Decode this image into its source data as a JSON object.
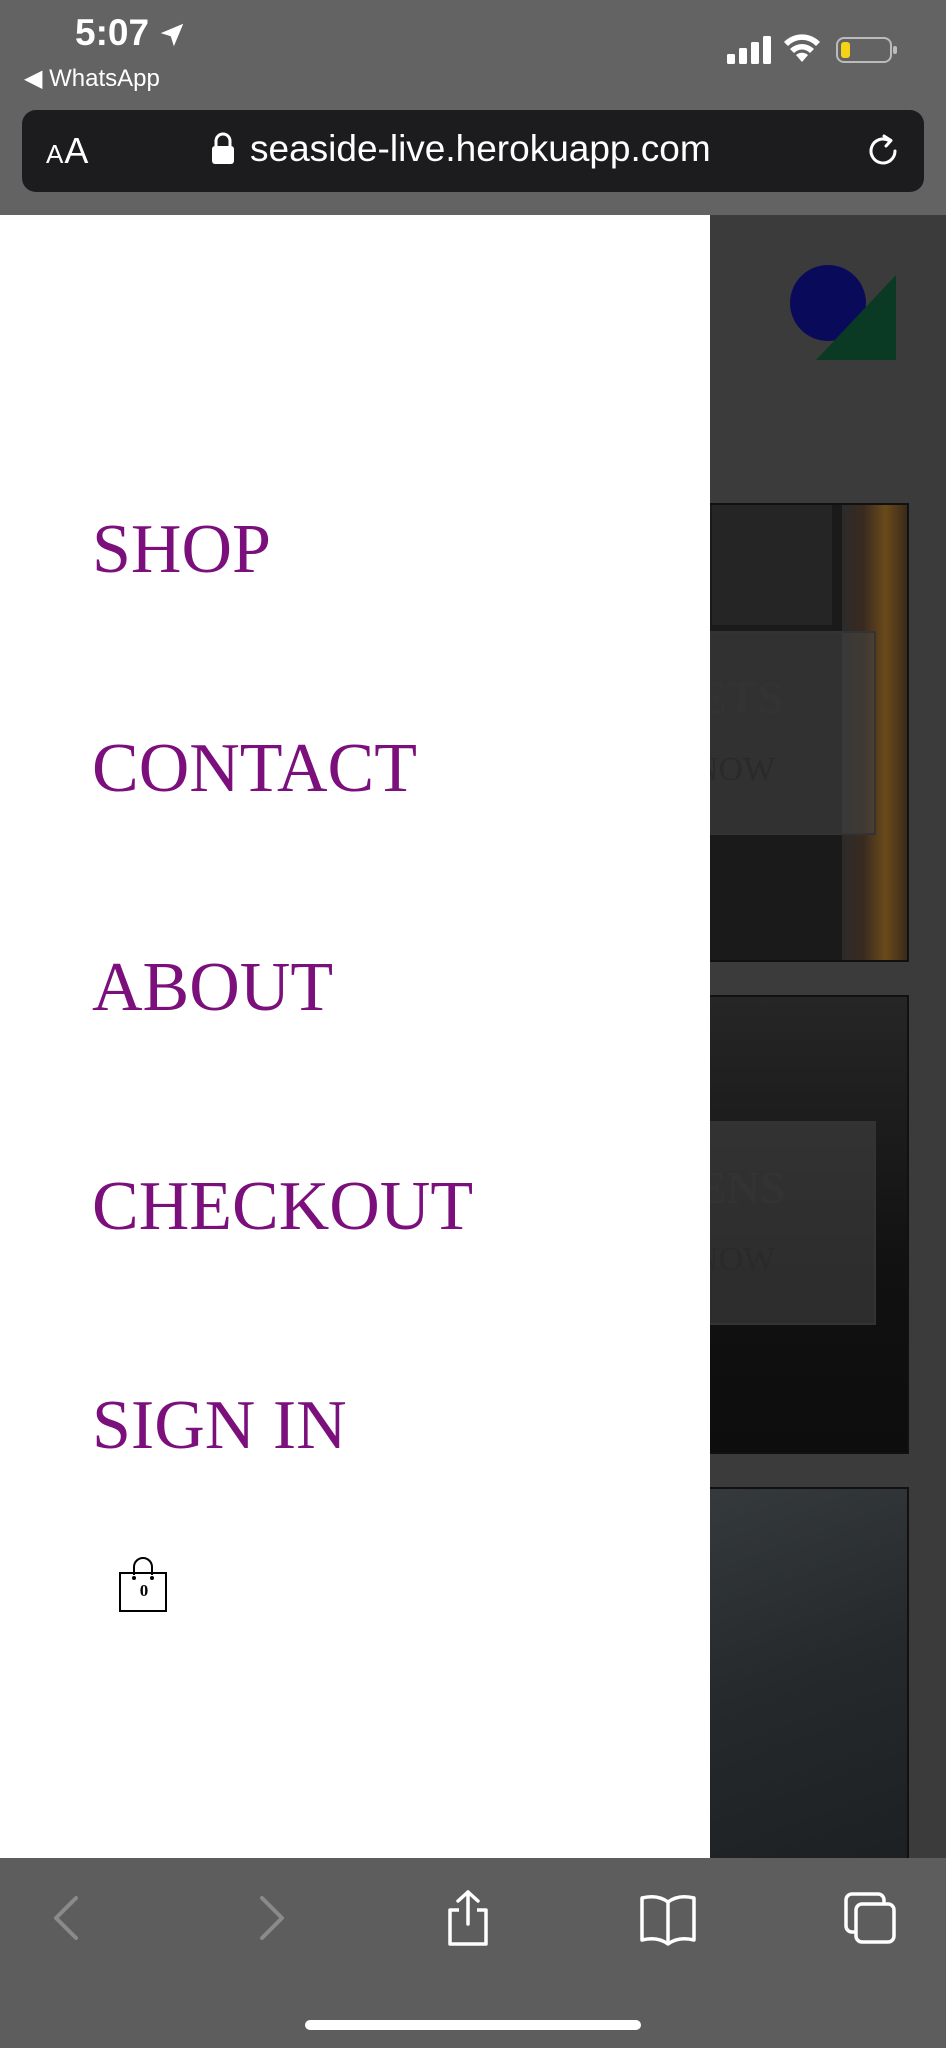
{
  "status_bar": {
    "time": "5:07",
    "back_app": "◀ WhatsApp"
  },
  "browser": {
    "text_size_label_small": "A",
    "text_size_label_large": "A",
    "url": "seaside-live.herokuapp.com"
  },
  "drawer": {
    "items": [
      {
        "label": "SHOP"
      },
      {
        "label": "CONTACT"
      },
      {
        "label": "ABOUT"
      },
      {
        "label": "CHECKOUT"
      },
      {
        "label": "SIGN IN"
      }
    ],
    "cart_count": "0"
  },
  "background_cards": [
    {
      "title_partial": "ETS",
      "cta_partial": "NOW"
    },
    {
      "title_partial": "ENS",
      "cta_partial": "NOW"
    }
  ],
  "colors": {
    "menu_text": "#7b0f7c",
    "drawer_bg": "#ffffff",
    "logo_circle": "#0a0a5a",
    "logo_triangle": "#0b3a24"
  }
}
